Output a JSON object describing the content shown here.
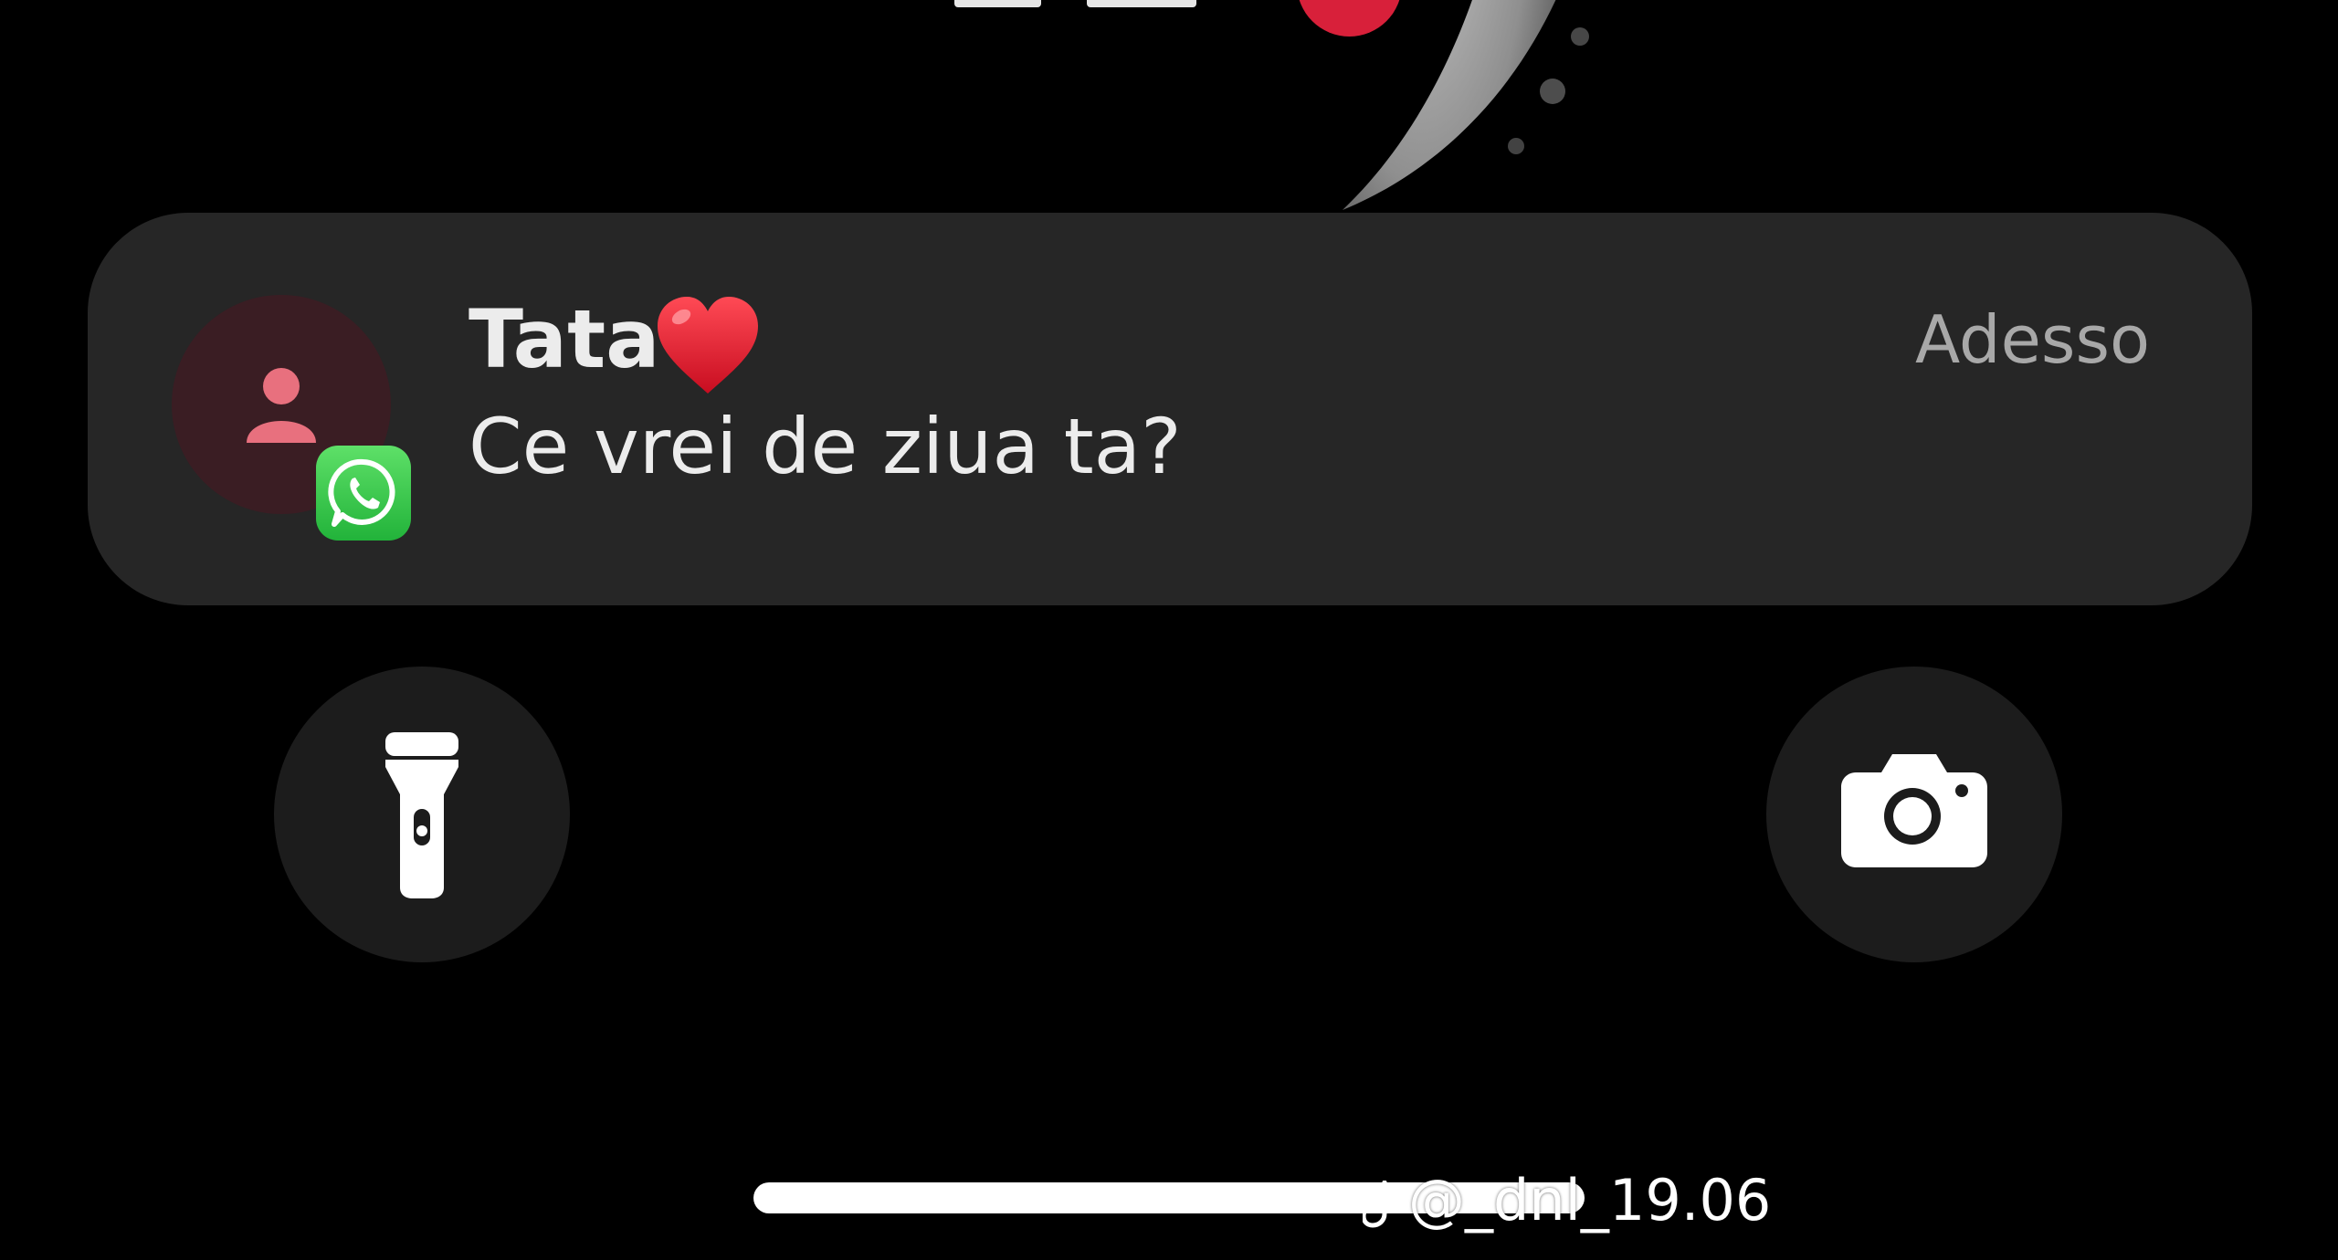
{
  "notification": {
    "sender": "Tata",
    "sender_emoji": "heart-emoji",
    "message": "Ce vrei de ziua ta?",
    "time": "Adesso",
    "app_icon": "whatsapp-icon",
    "avatar_icon": "person-icon"
  },
  "quick_actions": {
    "left": "flashlight-icon",
    "right": "camera-icon"
  },
  "watermark": {
    "logo": "tiktok-icon",
    "handle": "@_dnl_19.06"
  },
  "colors": {
    "background": "#000000",
    "notification_bg": "#262626",
    "avatar_bg": "#3a1d23",
    "avatar_fg": "#e8707e",
    "whatsapp_green": "#25d366",
    "heart_red": "#e0182d"
  }
}
